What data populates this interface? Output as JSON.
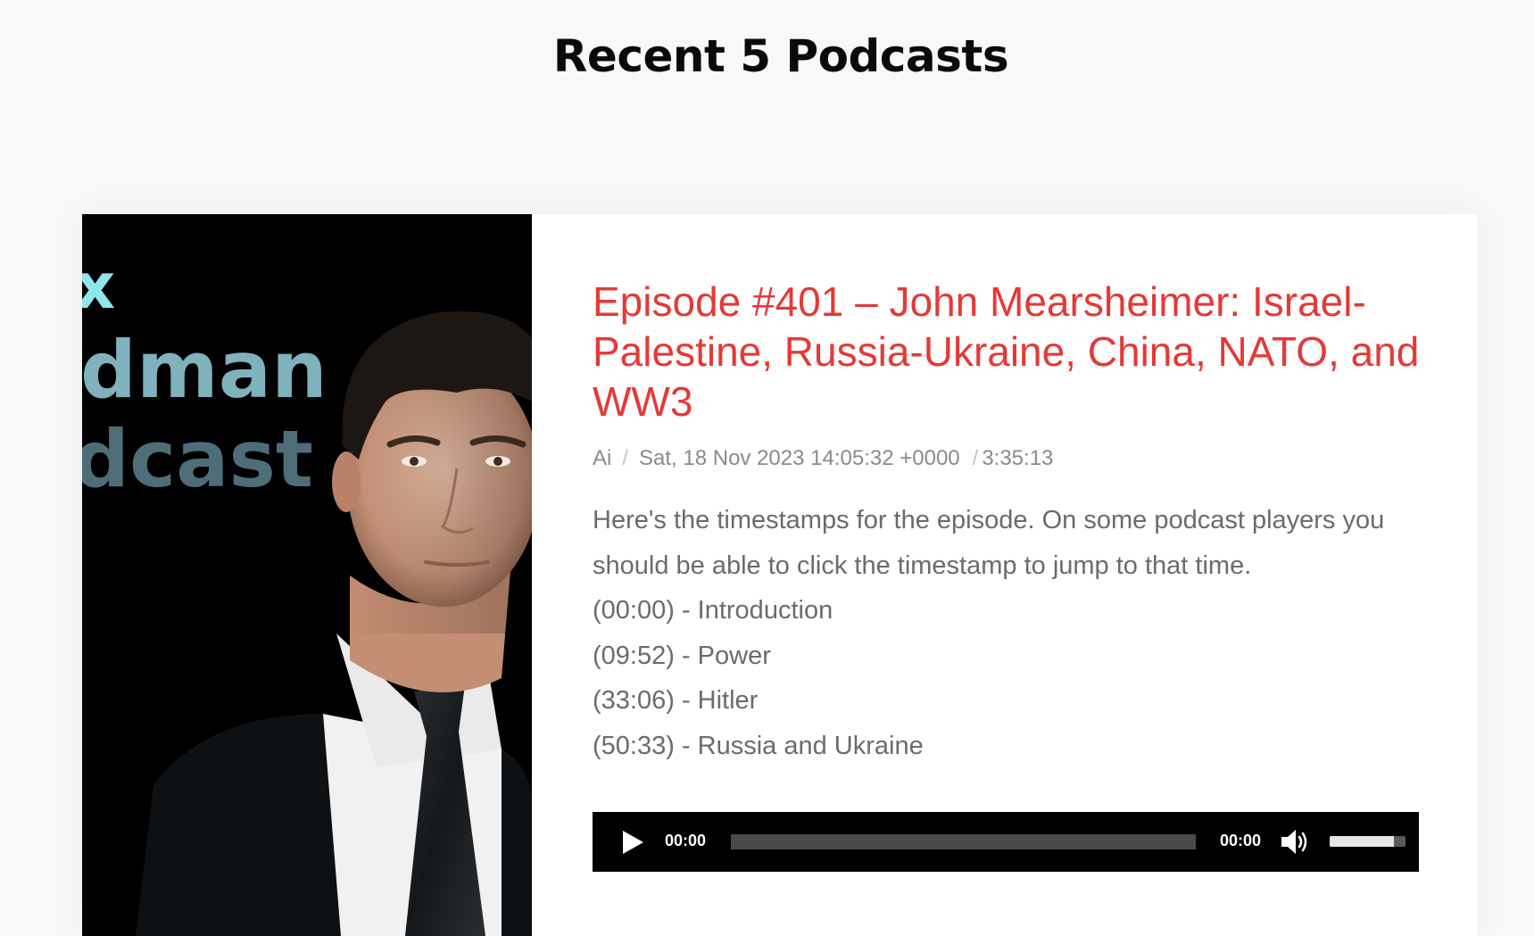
{
  "section": {
    "title": "Recent 5 Podcasts"
  },
  "cover": {
    "logo_lines": [
      "x",
      "dman",
      "dcast"
    ],
    "colors": {
      "x": "#8fe6ea",
      "dman": "#7fb2bc",
      "dcast": "#4f6d78"
    }
  },
  "episode": {
    "title": "Episode #401 – John Mearsheimer: Israel-Palestine, Russia-Ukraine, China, NATO, and WW3",
    "author": "Ai",
    "date": "Sat, 18 Nov 2023 14:05:32 +0000",
    "duration": "3:35:13",
    "description": [
      "Here's the timestamps for the episode. On some podcast players you should be able to click the timestamp to jump to that time.",
      "(00:00) - Introduction",
      "(09:52) - Power",
      "(33:06) - Hitler",
      "(50:33) - Russia and Ukraine"
    ]
  },
  "player": {
    "current_time": "00:00",
    "total_time": "00:00",
    "progress": 0,
    "volume": 0.85,
    "icons": {
      "play": "play-icon",
      "volume": "speaker-volume-icon"
    }
  },
  "colors": {
    "accent": "#e53935",
    "page_background": "#f7f8fa",
    "meta_text": "#8a8a8a",
    "body_text": "#6b6b6b"
  }
}
